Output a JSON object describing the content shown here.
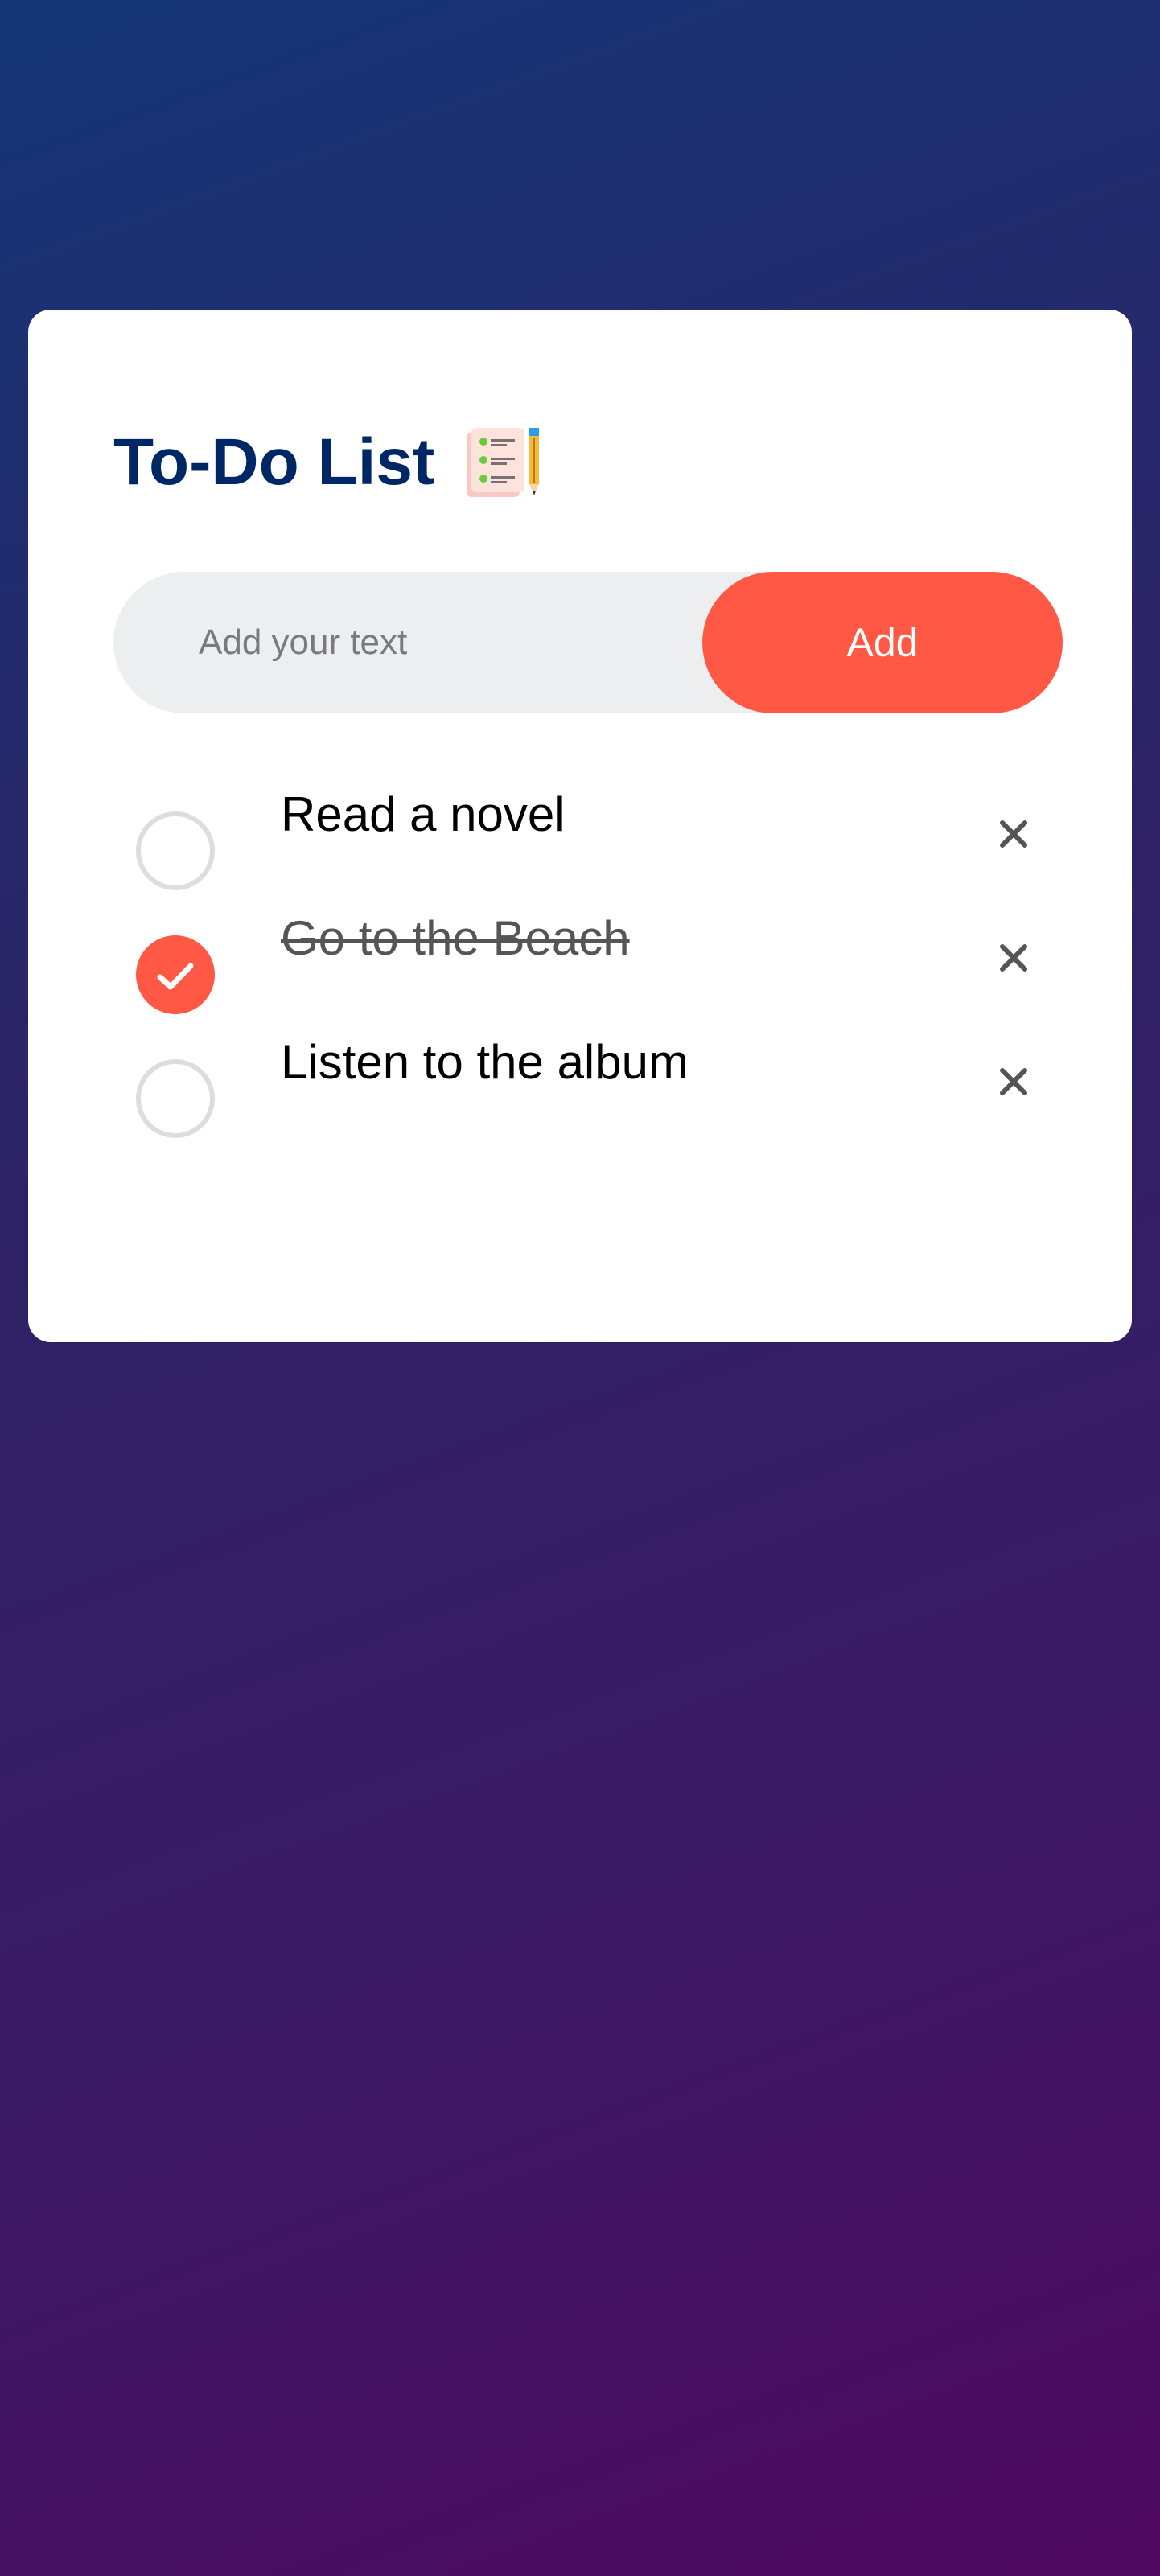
{
  "app": {
    "title": "To-Do List",
    "title_icon": "notepad-pencil-icon"
  },
  "input": {
    "placeholder": "Add your text",
    "value": "",
    "add_label": "Add"
  },
  "tasks": [
    {
      "text": "Read a novel",
      "completed": false
    },
    {
      "text": "Go to the Beach",
      "completed": true
    },
    {
      "text": "Listen to the album",
      "completed": false
    }
  ],
  "colors": {
    "accent": "#ff5945",
    "title": "#002765",
    "input_bg": "#edeef0",
    "unchecked_border": "#dddddd",
    "delete_icon": "#555555"
  }
}
